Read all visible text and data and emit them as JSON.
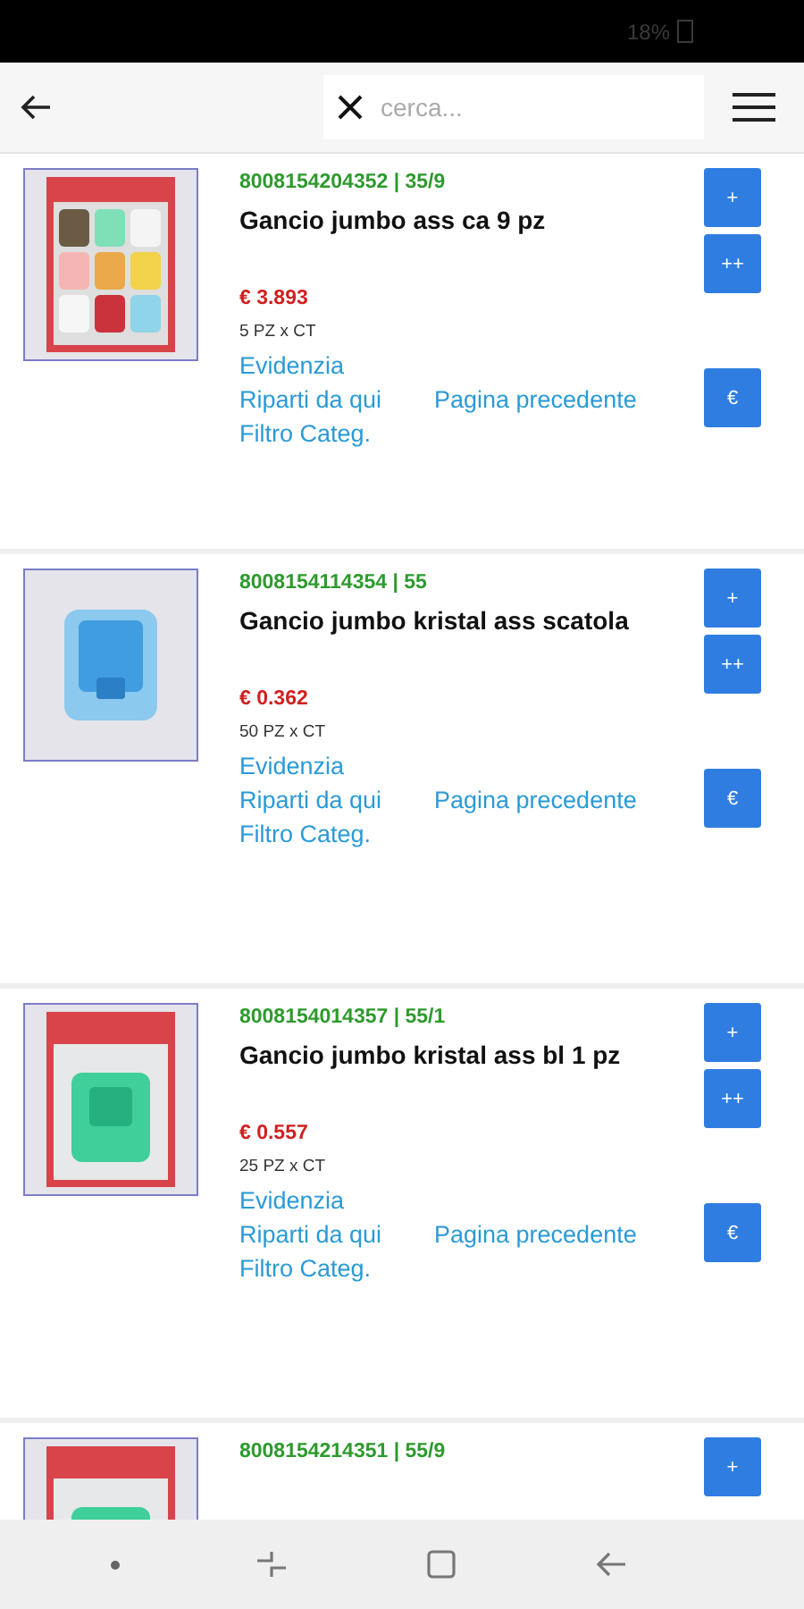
{
  "status_bar": {
    "battery": "18%"
  },
  "app_bar": {
    "search": {
      "placeholder": "cerca..."
    }
  },
  "products": [
    {
      "code": "8008154204352 | 35/9",
      "name": "Gancio jumbo ass ca 9 pz",
      "price": "€ 3.893",
      "pack": "5 PZ x CT",
      "links": [
        "Evidenzia",
        "Riparti da qui",
        "Pagina precedente",
        "Filtro Categ."
      ],
      "buttons": [
        "+",
        "++",
        "€"
      ]
    },
    {
      "code": "8008154114354 | 55",
      "name": "Gancio jumbo kristal ass scatola",
      "price": "€ 0.362",
      "pack": "50 PZ x CT",
      "links": [
        "Evidenzia",
        "Riparti da qui",
        "Pagina precedente",
        "Filtro Categ."
      ],
      "buttons": [
        "+",
        "++",
        "€"
      ]
    },
    {
      "code": "8008154014357 | 55/1",
      "name": "Gancio jumbo kristal ass bl 1 pz",
      "price": "€ 0.557",
      "pack": "25 PZ x CT",
      "links": [
        "Evidenzia",
        "Riparti da qui",
        "Pagina precedente",
        "Filtro Categ."
      ],
      "buttons": [
        "+",
        "++",
        "€"
      ]
    },
    {
      "code": "8008154214351 | 55/9",
      "buttons": [
        "+"
      ]
    }
  ]
}
